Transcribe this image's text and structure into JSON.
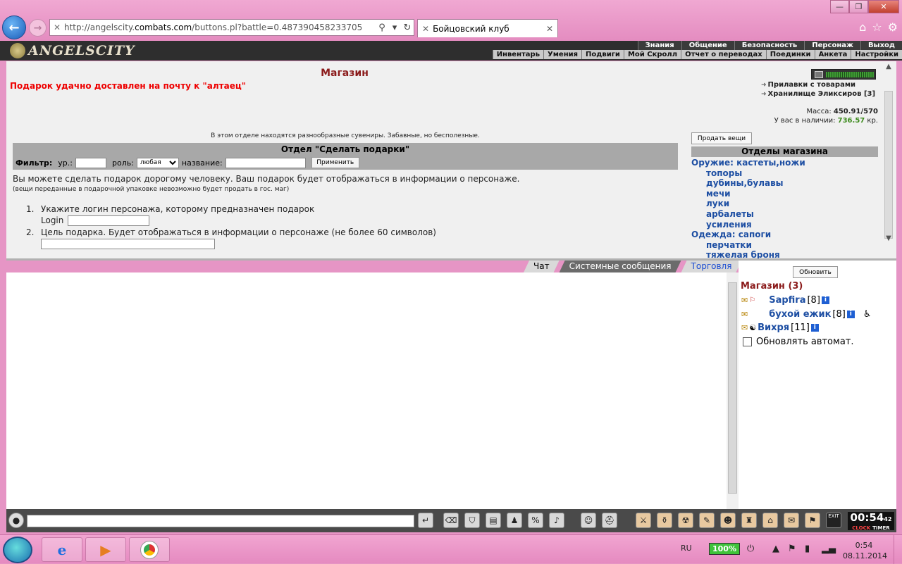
{
  "browser": {
    "url_prefix": "http://angelscity.",
    "url_domain": "combats.com",
    "url_suffix": "/buttons.pl?battle=0.487390458233705",
    "tab_title": "Бойцовский клуб"
  },
  "game": {
    "logo": "ANGELSCITY",
    "menu_top": [
      "Знания",
      "Общение",
      "Безопасность",
      "Персонаж",
      "Выход"
    ],
    "menu_sub": [
      "Инвентарь",
      "Умения",
      "Подвиги",
      "Мой Скролл",
      "Отчет о переводах",
      "Поединки",
      "Анкета",
      "Настройки"
    ]
  },
  "shop": {
    "title": "Магазин",
    "delivered_msg": "Подарок удачно доставлен на почту к \"алтаец\"",
    "links": [
      "Прилавки с товарами",
      "Хранилище Эликсиров [3]"
    ],
    "mass_label": "Масса:",
    "mass_value": "450.91/570",
    "money_label": "У вас в наличии:",
    "money_value": "736.57",
    "money_unit": "кр.",
    "dept_desc": "В этом отделе находятся разнообразные сувениры. Забавные, но бесполезные.",
    "gift_title": "Отдел \"Сделать подарки\"",
    "filter_label": "Фильтр:",
    "level_label": "ур.:",
    "role_label": "роль:",
    "role_value": "любая",
    "name_label": "название:",
    "apply_label": "Применить",
    "intro1": "Вы можете сделать подарок дорогому человеку. Ваш подарок будет отображаться в информации о персонаже.",
    "intro2": "(вещи переданные в подарочной упаковке невозможно будет продать в гос. маг)",
    "step1": "Укажите логин персонажа, которому предназначен подарок",
    "step1_login": "Login",
    "step2": "Цель подарка. Будет отображаться в информации о персонаже (не более 60 символов)",
    "sell_button": "Продать вещи",
    "depts_header": "Отделы магазина",
    "dept_main": "Оружие: кастеты,ножи",
    "dept_subs": [
      "топоры",
      "дубины,булавы",
      "мечи",
      "луки",
      "арбалеты",
      "усиления"
    ],
    "dept_main2": "Одежда: сапоги",
    "dept_subs2": [
      "перчатки",
      "тяжелая броня"
    ]
  },
  "chat": {
    "tabs": [
      "Чат",
      "Системные сообщения",
      "Торговля"
    ]
  },
  "online": {
    "refresh_label": "Обновить",
    "title": "Магазин (3)",
    "users": [
      {
        "nick": "Sapfira",
        "level": "[8]"
      },
      {
        "nick": "бухой ежик",
        "level": "[8]"
      },
      {
        "nick": "Вихря",
        "level": "[11]"
      }
    ],
    "auto_label": "Обновлять автомат."
  },
  "clock": {
    "time": "00:54",
    "sec": "42",
    "label1": "CLOCK",
    "label2": "TIMER",
    "exit": "EXIT"
  },
  "taskbar": {
    "lang": "RU",
    "battery": "100%",
    "time": "0:54",
    "date": "08.11.2014"
  }
}
